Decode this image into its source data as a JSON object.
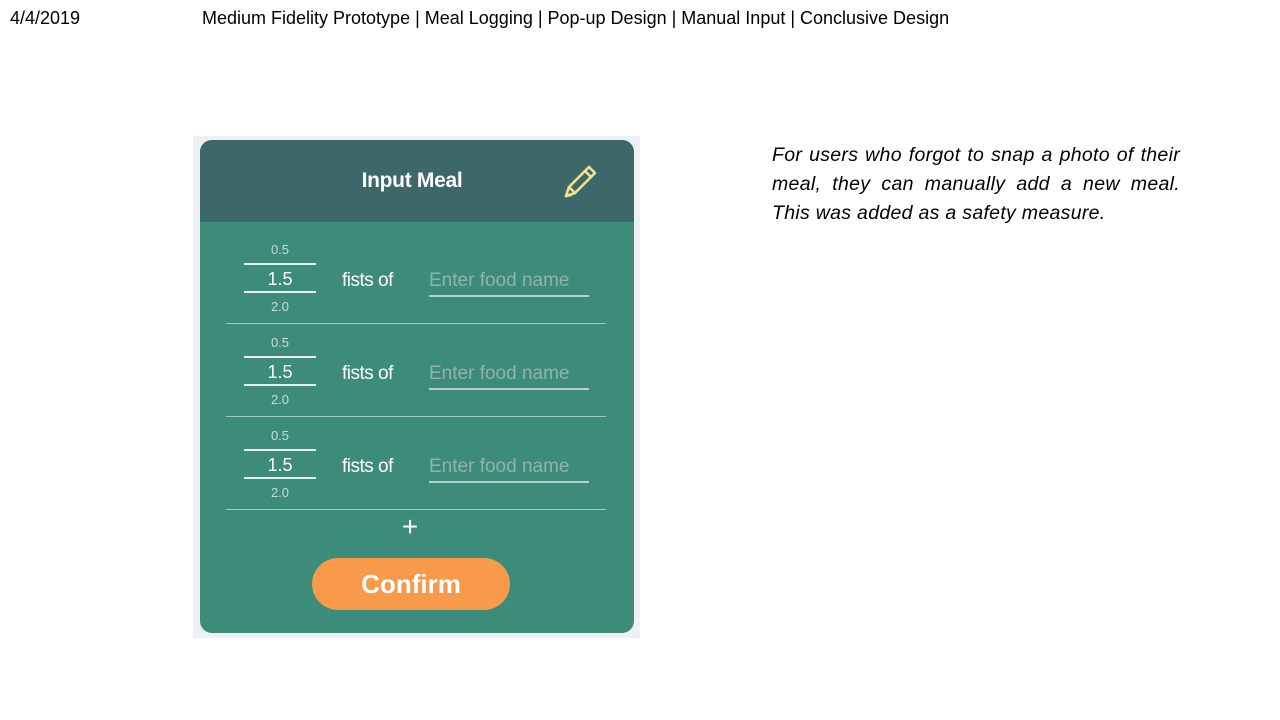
{
  "slide": {
    "date": "4/4/2019",
    "title": "Medium Fidelity Prototype | Meal Logging | Pop-up Design | Manual Input | Conclusive Design"
  },
  "modal": {
    "title": "Input Meal",
    "header_icon": "pencil-icon",
    "rows": [
      {
        "prev": "0.5",
        "value": "1.5",
        "next": "2.0",
        "unit": "fists of",
        "placeholder": "Enter food name"
      },
      {
        "prev": "0.5",
        "value": "1.5",
        "next": "2.0",
        "unit": "fists of",
        "placeholder": "Enter food name"
      },
      {
        "prev": "0.5",
        "value": "1.5",
        "next": "2.0",
        "unit": "fists of",
        "placeholder": "Enter food name"
      }
    ],
    "add_label": "+",
    "confirm_label": "Confirm",
    "colors": {
      "header": "#3e6769",
      "body": "#3d8b79",
      "confirm": "#f89a4a",
      "pencil": "#f3e38a"
    }
  },
  "note": "For users who forgot to snap a photo of their meal, they can manually add a new meal. This was added as a safety measure."
}
